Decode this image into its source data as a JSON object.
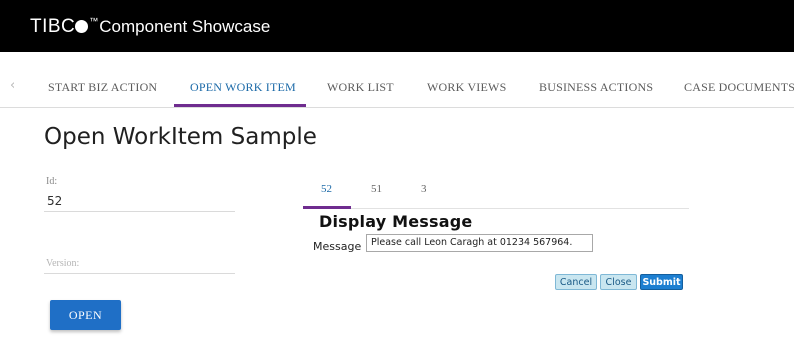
{
  "header": {
    "brand": "TIBC",
    "trademark": "™",
    "app_name": "Component Showcase"
  },
  "tabs": {
    "prev_arrow": "‹",
    "items": [
      {
        "label": "START BIZ ACTION"
      },
      {
        "label": "OPEN WORK ITEM"
      },
      {
        "label": "WORK LIST"
      },
      {
        "label": "WORK VIEWS"
      },
      {
        "label": "BUSINESS ACTIONS"
      },
      {
        "label": "CASE DOCUMENTS"
      }
    ],
    "active_index": 1
  },
  "page": {
    "title": "Open WorkItem Sample"
  },
  "form": {
    "id_label": "Id:",
    "id_value": "52",
    "version_placeholder": "Version:",
    "open_label": "OPEN"
  },
  "workitem_tabs": {
    "items": [
      {
        "label": "52"
      },
      {
        "label": "51"
      },
      {
        "label": "3"
      }
    ],
    "active_index": 0
  },
  "display": {
    "heading": "Display Message",
    "message_label": "Message",
    "message_value": "Please call Leon Caragh at 01234 567964.",
    "cancel_label": "Cancel",
    "close_label": "Close",
    "submit_label": "Submit"
  },
  "colors": {
    "header_bg": "#000000",
    "active_tab_text": "#1c6aa8",
    "tab_underline": "#6f2c8f",
    "primary_button": "#1f6fc6"
  }
}
